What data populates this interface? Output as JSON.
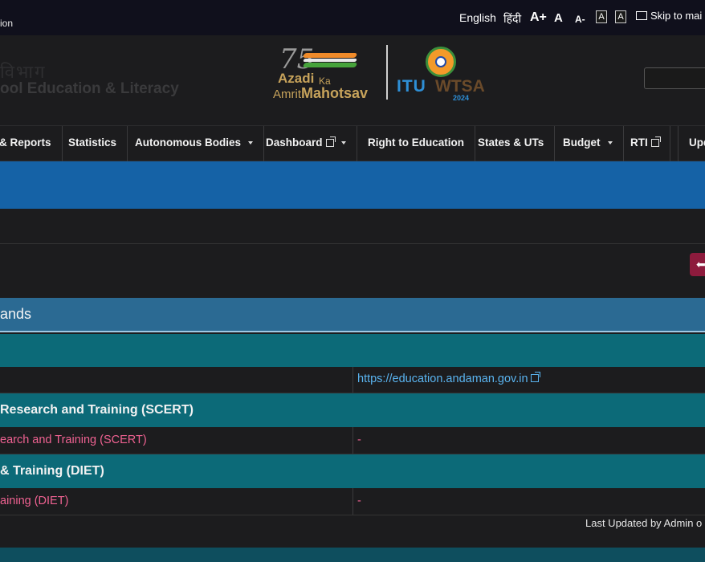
{
  "topbar": {
    "left_text": "ion",
    "lang_english": "English",
    "lang_hindi": "हिंदी",
    "font_increase": "A+",
    "font_normal": "A",
    "font_decrease": "A-",
    "contrast_light": "A",
    "contrast_dark": "A",
    "skip_label": "Skip to mai"
  },
  "header": {
    "dept_faded": "विभाग",
    "dept_title": "ool Education & Literacy",
    "azadi": {
      "number": "75",
      "line1": "Azadi",
      "ka": "Ka",
      "line2a": "Amrit",
      "line2b": "Mahotsav"
    },
    "itu": {
      "text": "ITU",
      "wtsa": "WTSA",
      "year": "2024"
    }
  },
  "nav": {
    "items": [
      {
        "label": "& Reports"
      },
      {
        "label": "Statistics"
      },
      {
        "label": "Autonomous Bodies"
      },
      {
        "label": "Dashboard"
      },
      {
        "label": "Right to Education"
      },
      {
        "label": "States & UTs"
      },
      {
        "label": "Budget"
      },
      {
        "label": "RTI"
      },
      {
        "label": "Upd"
      }
    ]
  },
  "section": {
    "title": "ands"
  },
  "rows": {
    "edu_link": "https://education.andaman.gov.in",
    "scert_head": "Research and Training (SCERT)",
    "scert_left": "earch and Training (SCERT)",
    "scert_right": "-",
    "diet_head": "& Training (DIET)",
    "diet_left": "aining (DIET)",
    "diet_right": "-"
  },
  "footer": {
    "updated": "Last Updated by Admin o"
  },
  "colors": {
    "banner": "#1562a6",
    "section": "#2b6a93",
    "teal": "#0c6a78",
    "link": "#5ab4f0",
    "pink": "#f06292",
    "back": "#8d1b3d"
  }
}
